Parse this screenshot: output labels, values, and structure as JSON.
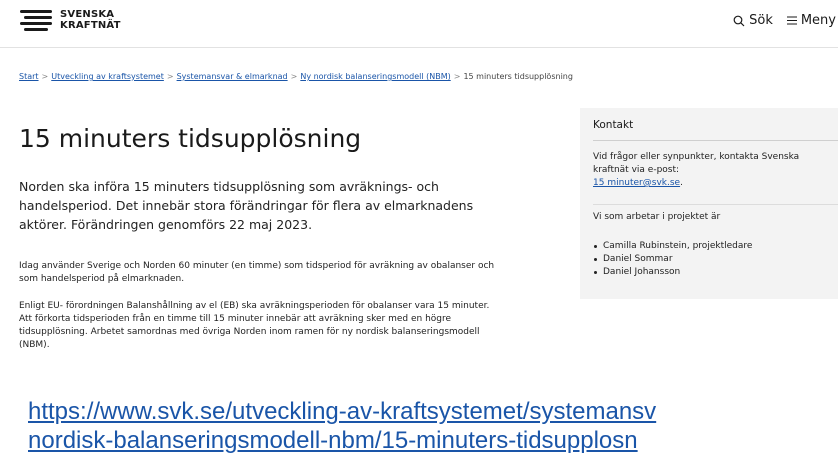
{
  "header": {
    "logo_line1": "SVENSKA",
    "logo_line2": "KRAFTNÄT",
    "search_label": "Sök",
    "menu_label": "Meny"
  },
  "breadcrumb": {
    "items": [
      "Start",
      "Utveckling av kraftsystemet",
      "Systemansvar & elmarknad",
      "Ny nordisk balanseringsmodell (NBM)"
    ],
    "current": "15 minuters tidsupplösning",
    "separator": ">"
  },
  "article": {
    "title": "15 minuters tidsupplösning",
    "lead": "Norden ska införa 15 minuters tidsupplösning som avräknings- och handelsperiod. Det innebär stora förändringar för flera av elmarknadens aktörer. Förändringen genomförs 22 maj 2023.",
    "paragraph1": "Idag använder Sverige och Norden 60 minuter (en timme) som tidsperiod för avräkning av obalanser och som handelsperiod på elmarknaden.",
    "paragraph2": "Enligt EU- förordningen Balanshållning av el (EB) ska avräkningsperioden för obalanser vara 15 minuter. Att förkorta tidsperioden från en timme till 15 minuter innebär att avräkning sker med en högre tidsupplösning. Arbetet samordnas med övriga Norden inom ramen för ny nordisk balanseringsmodell (NBM)."
  },
  "contact": {
    "heading": "Kontakt",
    "intro": "Vid frågor eller synpunkter, kontakta Svenska kraftnät via e-post:",
    "email": "15 minuter@svk.se",
    "email_suffix": ".",
    "team_intro": "Vi som arbetar i projektet är",
    "members": [
      "Camilla Rubinstein, projektledare",
      "Daniel Sommar",
      "Daniel Johansson"
    ]
  },
  "url": {
    "line1": "https://www.svk.se/utveckling-av-kraftsystemet/systemansv",
    "line2": "nordisk-balanseringsmodell-nbm/15-minuters-tidsupplosn"
  },
  "colors": {
    "link": "#1a55a8",
    "panel": "#f3f3f3",
    "text": "#1a1a1a"
  }
}
